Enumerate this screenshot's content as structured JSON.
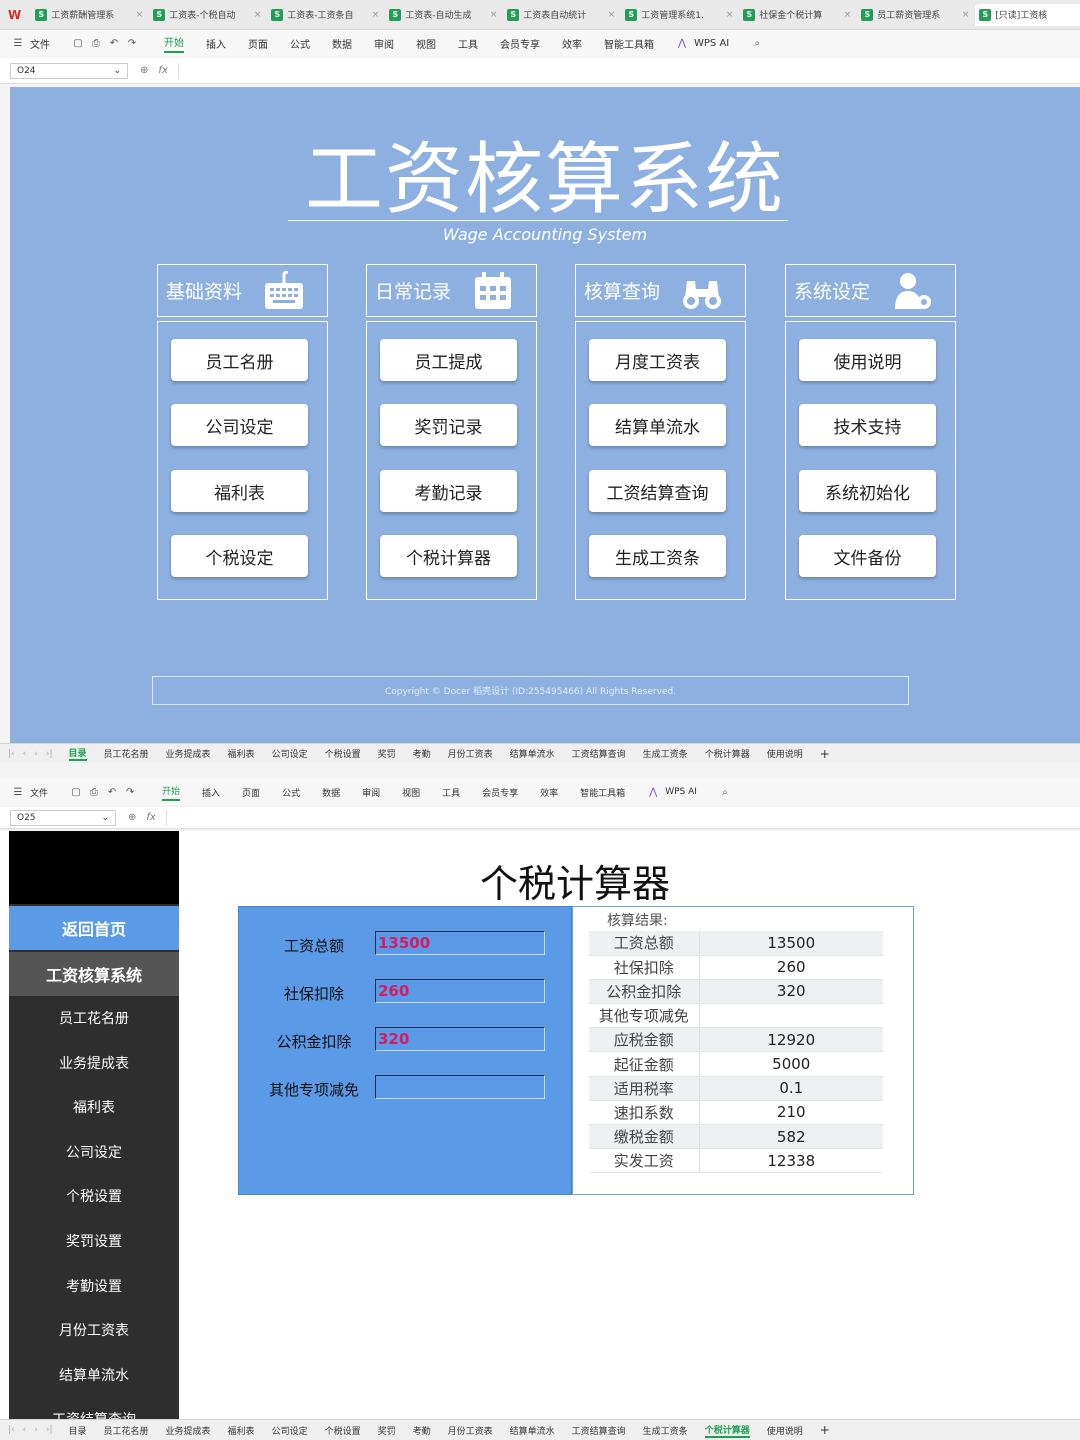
{
  "top_window": {
    "file_tabs": [
      {
        "label": "工资薪酬管理系"
      },
      {
        "label": "工资表-个税自动"
      },
      {
        "label": "工资表-工资条自"
      },
      {
        "label": "工资表-自动生成"
      },
      {
        "label": "工资表自动统计"
      },
      {
        "label": "工资管理系统1."
      },
      {
        "label": "社保金个税计算"
      },
      {
        "label": "员工薪资管理系"
      },
      {
        "label": "[只读]工资核"
      }
    ],
    "menu": [
      "文件",
      "开始",
      "插入",
      "页面",
      "公式",
      "数据",
      "审阅",
      "视图",
      "工具",
      "会员专享",
      "效率",
      "智能工具箱",
      "WPS AI"
    ],
    "cell_ref": "O24",
    "fx_label": "fx"
  },
  "dashboard": {
    "title": "工资核算系统",
    "subtitle": "Wage Accounting System",
    "columns": [
      {
        "heading": "基础资料",
        "icon": "keyboard-icon",
        "buttons": [
          "员工名册",
          "公司设定",
          "福利表",
          "个税设定"
        ]
      },
      {
        "heading": "日常记录",
        "icon": "calendar-icon",
        "buttons": [
          "员工提成",
          "奖罚记录",
          "考勤记录",
          "个税计算器"
        ]
      },
      {
        "heading": "核算查询",
        "icon": "binoculars-icon",
        "buttons": [
          "月度工资表",
          "结算单流水",
          "工资结算查询",
          "生成工资条"
        ]
      },
      {
        "heading": "系统设定",
        "icon": "user-settings-icon",
        "buttons": [
          "使用说明",
          "技术支持",
          "系统初始化",
          "文件备份"
        ]
      }
    ],
    "copyright": "Copyright © Docer 稻壳设计 (ID:255495466) All Rights Reserved."
  },
  "sheet_tabs_top": [
    "目录",
    "员工花名册",
    "业务提成表",
    "福利表",
    "公司设定",
    "个税设置",
    "奖罚",
    "考勤",
    "月份工资表",
    "结算单流水",
    "工资结算查询",
    "生成工资条",
    "个税计算器",
    "使用说明"
  ],
  "bottom_window": {
    "menu": [
      "文件",
      "开始",
      "插入",
      "页面",
      "公式",
      "数据",
      "审阅",
      "视图",
      "工具",
      "会员专享",
      "效率",
      "智能工具箱",
      "WPS AI"
    ],
    "cell_ref": "O25",
    "fx_label": "fx"
  },
  "calculator": {
    "sidebar": {
      "home": "返回首页",
      "system": "工资核算系统",
      "items": [
        "员工花名册",
        "业务提成表",
        "福利表",
        "公司设定",
        "个税设置",
        "奖罚设置",
        "考勤设置",
        "月份工资表",
        "结算单流水",
        "工资结算查询"
      ]
    },
    "title": "个税计算器",
    "inputs": [
      {
        "label": "工资总额",
        "value": "13500"
      },
      {
        "label": "社保扣除",
        "value": "260"
      },
      {
        "label": "公积金扣除",
        "value": "320"
      },
      {
        "label": "其他专项减免",
        "value": ""
      }
    ],
    "result_heading": "核算结果:",
    "results": [
      {
        "label": "工资总额",
        "value": "13500"
      },
      {
        "label": "社保扣除",
        "value": "260"
      },
      {
        "label": "公积金扣除",
        "value": "320"
      },
      {
        "label": "其他专项减免",
        "value": ""
      },
      {
        "label": "应税金额",
        "value": "12920"
      },
      {
        "label": "起征金额",
        "value": "5000"
      },
      {
        "label": "适用税率",
        "value": "0.1"
      },
      {
        "label": "速扣系数",
        "value": "210"
      },
      {
        "label": "缴税金额",
        "value": "582"
      },
      {
        "label": "实发工资",
        "value": "12338"
      }
    ]
  },
  "sheet_tabs_bottom": [
    "目录",
    "员工花名册",
    "业务提成表",
    "福利表",
    "公司设定",
    "个税设置",
    "奖罚",
    "考勤",
    "月份工资表",
    "结算单流水",
    "工资结算查询",
    "生成工资条",
    "个税计算器",
    "使用说明"
  ],
  "colors": {
    "dashboard_bg": "#8db0e0",
    "panel_blue": "#5a9ae6",
    "accent_green": "#1e9f55",
    "input_red": "#d81b60"
  }
}
